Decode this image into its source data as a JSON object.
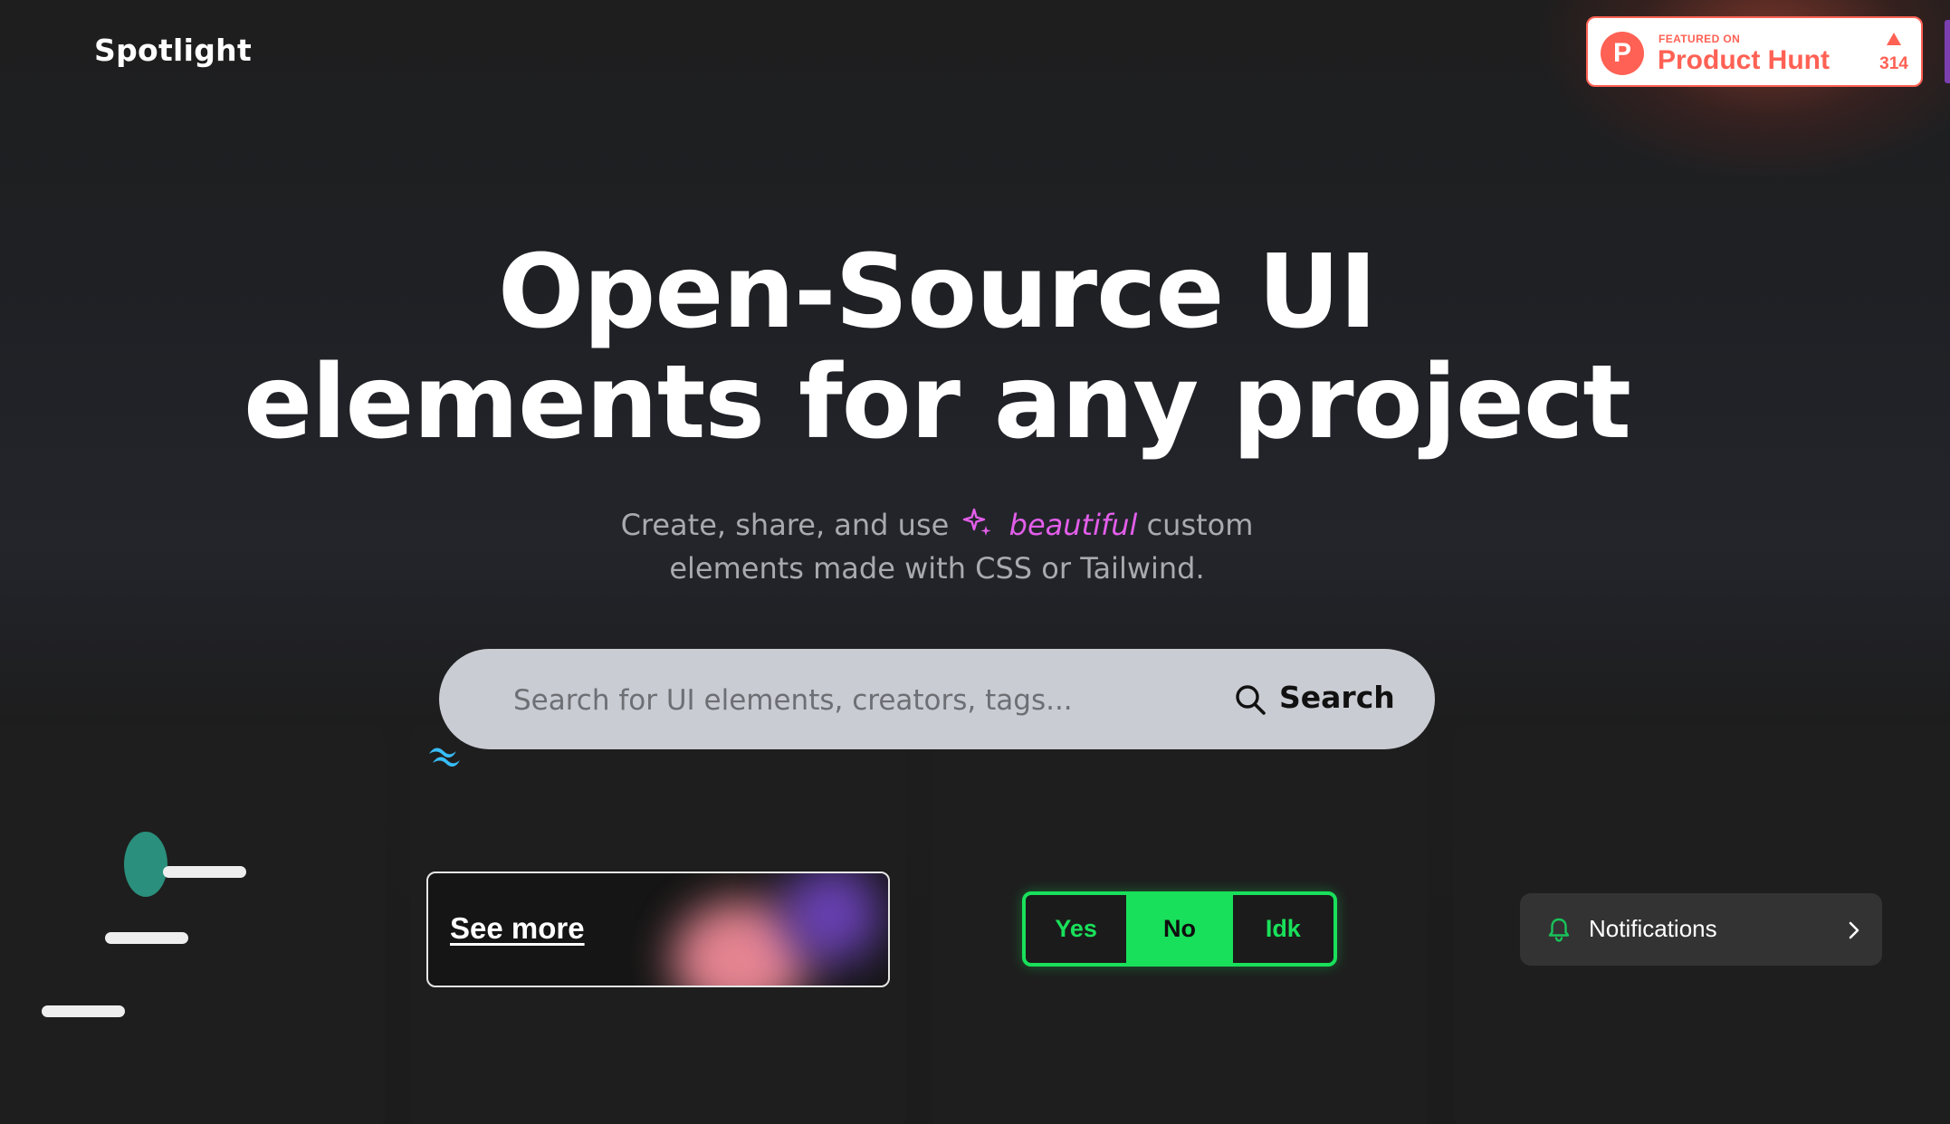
{
  "header": {
    "logo_text": "Spotlight"
  },
  "product_hunt": {
    "featured_label": "FEATURED ON",
    "name": "Product Hunt",
    "logo_letter": "P",
    "upvote_count": "314",
    "accent_color": "#ff6154"
  },
  "hero": {
    "title_line1": "Open-Source UI",
    "title_line2": "elements for any project",
    "subtitle_part1": "Create, share, and use",
    "subtitle_highlight": "beautiful",
    "subtitle_part2": "custom",
    "subtitle_line2": "elements made with CSS or Tailwind.",
    "highlight_color": "#e35eea",
    "sparkle_icon": "sparkle-icon"
  },
  "search": {
    "placeholder": "Search for UI elements, creators, tags...",
    "value": "",
    "button_label": "Search",
    "icon": "search-icon"
  },
  "cards": {
    "loader": {
      "blob_color": "#2a8f7c"
    },
    "see_more": {
      "tech_icon": "tailwind-icon",
      "label": "See more"
    },
    "toggle": {
      "options": [
        "Yes",
        "No",
        "Idk"
      ],
      "selected": "No",
      "accent_color": "#19e05a"
    },
    "notifications": {
      "label": "Notifications",
      "icon": "bell-icon",
      "trailing_icon": "chevron-right-icon"
    }
  }
}
